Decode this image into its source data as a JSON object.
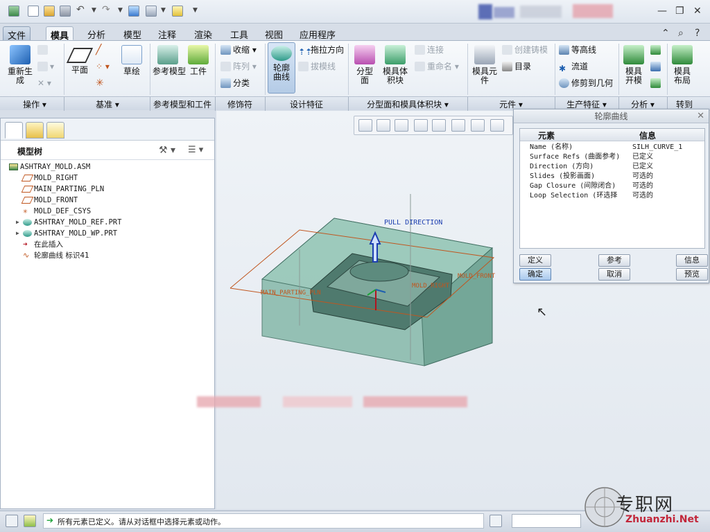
{
  "menu": {
    "tabs": [
      "文件",
      "模具",
      "分析",
      "模型",
      "注释",
      "渲染",
      "工具",
      "视图",
      "应用程序"
    ],
    "active": "模具"
  },
  "ribbon": {
    "regenerate": "重新生成",
    "plane": "平面",
    "sketch": "草绘",
    "ref_model": "参考模型",
    "workpiece": "工件",
    "shrink": "收缩",
    "pattern": "阵列",
    "classify": "分类",
    "silhouette": "轮廓曲线",
    "pull_direction": "拖拉方向",
    "draft_line": "拔模线",
    "parting_surface": "分型面",
    "mold_volume": "模具体积块",
    "connect": "连接",
    "rename": "重命名",
    "mold_component": "模具元件",
    "create_casting": "创建铸模",
    "catalog": "目录",
    "contour_line": "等高线",
    "flow_path": "流道",
    "trim_geometry": "修剪到几何",
    "mold_open": "模具开模",
    "mold_layout": "模具布局",
    "groups": {
      "operations": "操作",
      "datum": "基准",
      "ref_model_workpiece": "参考模型和工件",
      "decoration": "修饰符",
      "design_feature": "设计特征",
      "parting_volume": "分型面和模具体积块",
      "components": "元件",
      "production": "生产特征",
      "analysis": "分析",
      "goto": "转到"
    }
  },
  "model_tree": {
    "title": "模型树",
    "items": [
      {
        "label": "ASHTRAY_MOLD.ASM",
        "type": "asm",
        "indent": 0,
        "expandable": false
      },
      {
        "label": "MOLD_RIGHT",
        "type": "plane",
        "indent": 1,
        "expandable": false
      },
      {
        "label": "MAIN_PARTING_PLN",
        "type": "plane",
        "indent": 1,
        "expandable": false
      },
      {
        "label": "MOLD_FRONT",
        "type": "plane",
        "indent": 1,
        "expandable": false
      },
      {
        "label": "MOLD_DEF_CSYS",
        "type": "csys",
        "indent": 1,
        "expandable": false
      },
      {
        "label": "ASHTRAY_MOLD_REF.PRT",
        "type": "part",
        "indent": 1,
        "expandable": true
      },
      {
        "label": "ASHTRAY_MOLD_WP.PRT",
        "type": "part",
        "indent": 1,
        "expandable": true
      },
      {
        "label": "在此插入",
        "type": "insert",
        "indent": 1,
        "expandable": false
      },
      {
        "label": "轮廓曲线 标识41",
        "type": "curve",
        "indent": 1,
        "expandable": false
      }
    ]
  },
  "viewport": {
    "pull_direction": "PULL DIRECTION",
    "main_parting": "MAIN_PARTING_PLN",
    "mold_right": "MOLD_RIGHT",
    "mold_front": "MOLD_FRONT"
  },
  "dialog": {
    "title": "轮廓曲线",
    "col_element": "元素",
    "col_info": "信息",
    "rows": [
      {
        "element": "Name (名称)",
        "info": "SILH_CURVE_1"
      },
      {
        "element": "Surface Refs (曲面参考)",
        "info": "已定义"
      },
      {
        "element": "Direction (方向)",
        "info": "已定义"
      },
      {
        "element": "Slides (投影画面)",
        "info": "可选的"
      },
      {
        "element": "Gap Closure (间隙闭合)",
        "info": "可选的"
      },
      {
        "element": "Loop Selection (环选择",
        "info": "可选的"
      }
    ],
    "buttons": {
      "define": "定义",
      "reference": "参考",
      "info": "信息",
      "ok": "确定",
      "cancel": "取消",
      "preview": "预览"
    }
  },
  "status": {
    "message": "所有元素已定义。请从对话框中选择元素或动作。"
  },
  "watermark": {
    "cn": "专职网",
    "en": "Zhuanzhi.Net"
  },
  "colors": {
    "ribbon_bg": "#eef2f7",
    "accent_blue": "#1d5fb0",
    "mold_green": "#7fb3a5",
    "curve_orange": "#c0561f",
    "status_red": "#b3121f"
  }
}
